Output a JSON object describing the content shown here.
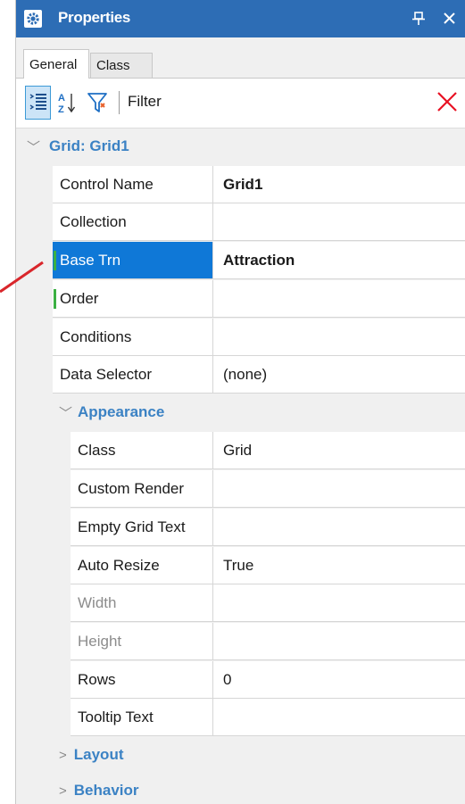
{
  "window": {
    "title": "Properties"
  },
  "tabs": [
    {
      "label": "General",
      "active": true
    },
    {
      "label": "Class",
      "active": false
    }
  ],
  "toolbar": {
    "filter_label": "Filter",
    "filter_value": ""
  },
  "grid": {
    "category": {
      "label": "Grid: Grid1",
      "expanded": true
    },
    "rows": [
      {
        "name": "Control Name",
        "value": "Grid1"
      },
      {
        "name": "Collection",
        "value": ""
      },
      {
        "name": "Base Trn",
        "value": "Attraction",
        "selected": true
      },
      {
        "name": "Order",
        "value": ""
      },
      {
        "name": "Conditions",
        "value": ""
      },
      {
        "name": "Data Selector",
        "value": "(none)"
      }
    ],
    "appearance": {
      "label": "Appearance",
      "expanded": true,
      "rows": [
        {
          "name": "Class",
          "value": "Grid"
        },
        {
          "name": "Custom Render",
          "value": ""
        },
        {
          "name": "Empty Grid Text",
          "value": ""
        },
        {
          "name": "Auto Resize",
          "value": "True"
        },
        {
          "name": "Width",
          "value": "",
          "disabled": true
        },
        {
          "name": "Height",
          "value": "",
          "disabled": true
        },
        {
          "name": "Rows",
          "value": "0"
        },
        {
          "name": "Tooltip Text",
          "value": ""
        }
      ]
    },
    "layout": {
      "label": "Layout",
      "expanded": false
    },
    "behavior": {
      "label": "Behavior",
      "expanded": false
    }
  },
  "colors": {
    "titlebar": "#2d6db5",
    "category_text": "#3b82c4",
    "selection": "#0f78d7",
    "modified_marker": "#3cb043",
    "clear_icon": "#e81123",
    "annotation_arrow": "#d9262b"
  }
}
